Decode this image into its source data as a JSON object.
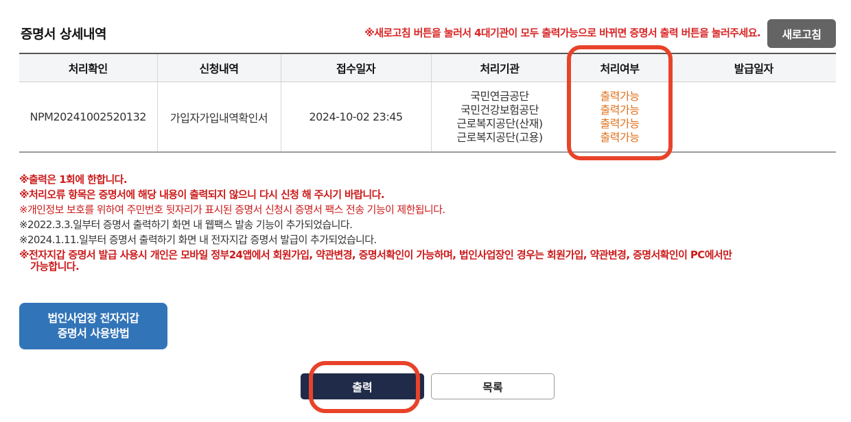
{
  "header": {
    "title": "증명서 상세내역",
    "notice": "※새로고침 버튼을 눌러서 4대기관이 모두 출력가능으로 바뀌면 증명서 출력 버튼을 눌러주세요.",
    "refresh_label": "새로고침"
  },
  "table": {
    "columns": [
      "처리확인",
      "신청내역",
      "접수일자",
      "처리기관",
      "처리여부",
      "발급일자"
    ],
    "row": {
      "confirm_no": "NPM20241002520132",
      "request": "가입자가입내역확인서",
      "received": "2024-10-02 23:45",
      "agencies": [
        "국민연금공단",
        "국민건강보험공단",
        "근로복지공단(산재)",
        "근로복지공단(고용)"
      ],
      "statuses": [
        "출력가능",
        "출력가능",
        "출력가능",
        "출력가능"
      ],
      "issued": ""
    }
  },
  "notes": {
    "n1": "※출력은 1회에 한합니다.",
    "n2": "※처리오류 항목은 증명서에 해당 내용이 출력되지 않으니 다시 신청 해 주시기 바랍니다.",
    "n3": "※개인정보 보호를 위하여 주민번호 뒷자리가 표시된 증명서 신청시 증명서 팩스 전송 기능이 제한됩니다.",
    "n4": "※2022.3.3.일부터 증명서 출력하기 화면 내 웹팩스 발송 기능이 추가되었습니다.",
    "n5": "※2024.1.11.일부터 증명서 출력하기 화면 내 전자지갑 증명서 발급이 추가되었습니다.",
    "n6_line1": "※전자지갑 증명서 발급 사용시 개인은 모바일 정부24앱에서 회원가입, 약관변경, 증명서확인이 가능하며, 법인사업장인 경우는 회원가입, 약관변경, 증명서확인이 PC에서만",
    "n6_line2": "가능합니다."
  },
  "buttons": {
    "guide_line1": "법인사업장 전자지갑",
    "guide_line2": "증명서 사용방법",
    "print": "출력",
    "list": "목록"
  },
  "colors": {
    "status_orange": "#e0701c",
    "notice_red": "#d92525",
    "highlight": "#e8432a",
    "print_navy": "#1f2b48",
    "guide_blue": "#3274b8"
  }
}
